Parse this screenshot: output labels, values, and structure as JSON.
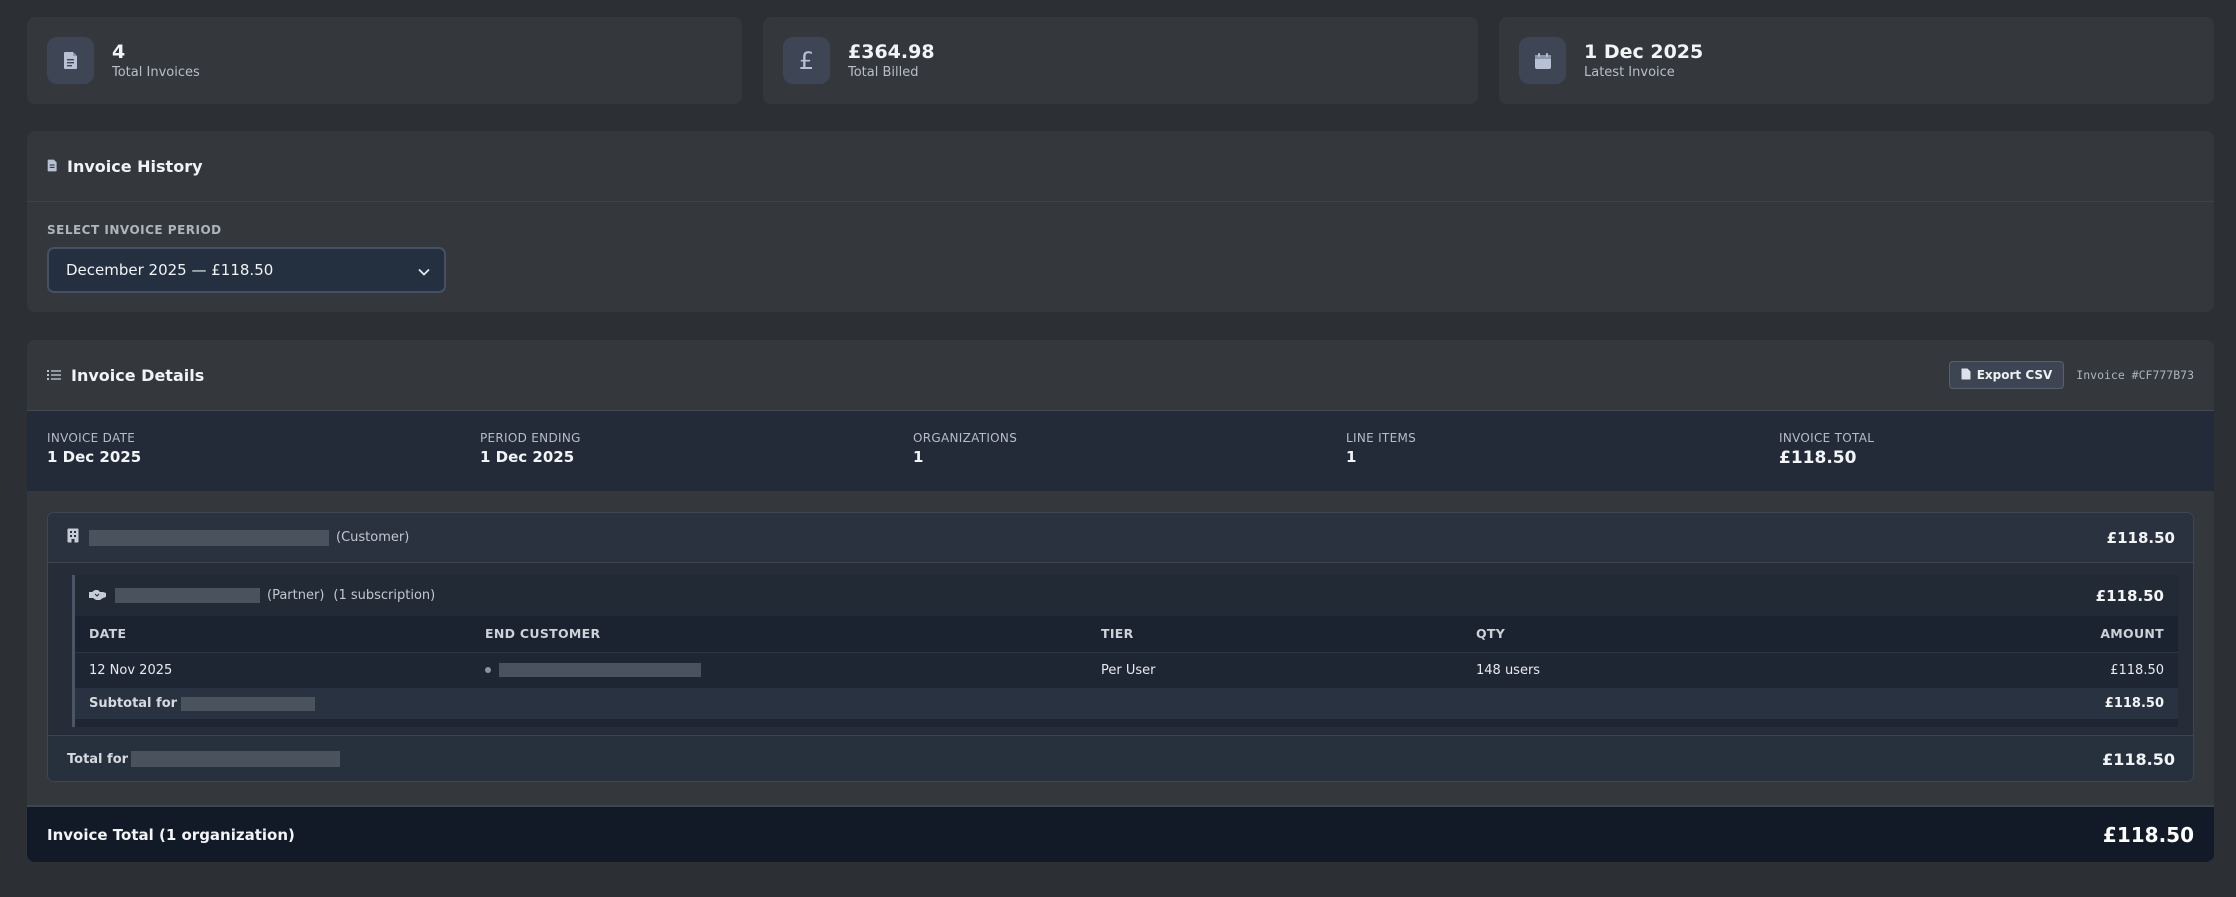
{
  "stats": [
    {
      "icon": "document-icon",
      "value": "4",
      "label": "Total Invoices"
    },
    {
      "icon": "pound-icon",
      "glyph": "£",
      "value": "£364.98",
      "label": "Total Billed"
    },
    {
      "icon": "calendar-icon",
      "value": "1 Dec 2025",
      "label": "Latest Invoice"
    }
  ],
  "history": {
    "title": "Invoice History",
    "period_label": "SELECT INVOICE PERIOD",
    "selected_period": "December 2025 — £118.50"
  },
  "details": {
    "title": "Invoice Details",
    "export_label": "Export CSV",
    "invoice_id": "Invoice #CF777B73",
    "meta": {
      "invoice_date_label": "INVOICE DATE",
      "invoice_date": "1 Dec 2025",
      "period_ending_label": "PERIOD ENDING",
      "period_ending": "1 Dec 2025",
      "organizations_label": "ORGANIZATIONS",
      "organizations": "1",
      "line_items_label": "LINE ITEMS",
      "line_items": "1",
      "invoice_total_label": "INVOICE TOTAL",
      "invoice_total": "£118.50"
    },
    "org": {
      "role": "(Customer)",
      "amount": "£118.50",
      "partner": {
        "role": "(Partner)",
        "subscriptions": "(1 subscription)",
        "amount": "£118.50",
        "columns": {
          "date": "DATE",
          "end_customer": "END CUSTOMER",
          "tier": "TIER",
          "qty": "QTY",
          "amount": "AMOUNT"
        },
        "rows": [
          {
            "date": "12 Nov 2025",
            "tier": "Per User",
            "qty": "148 users",
            "amount": "£118.50"
          }
        ],
        "subtotal_label": "Subtotal for",
        "subtotal_amount": "£118.50"
      },
      "total_label": "Total for",
      "total_amount": "£118.50"
    },
    "grand_total_label": "Invoice Total (1 organization)",
    "grand_total_amount": "£118.50"
  }
}
